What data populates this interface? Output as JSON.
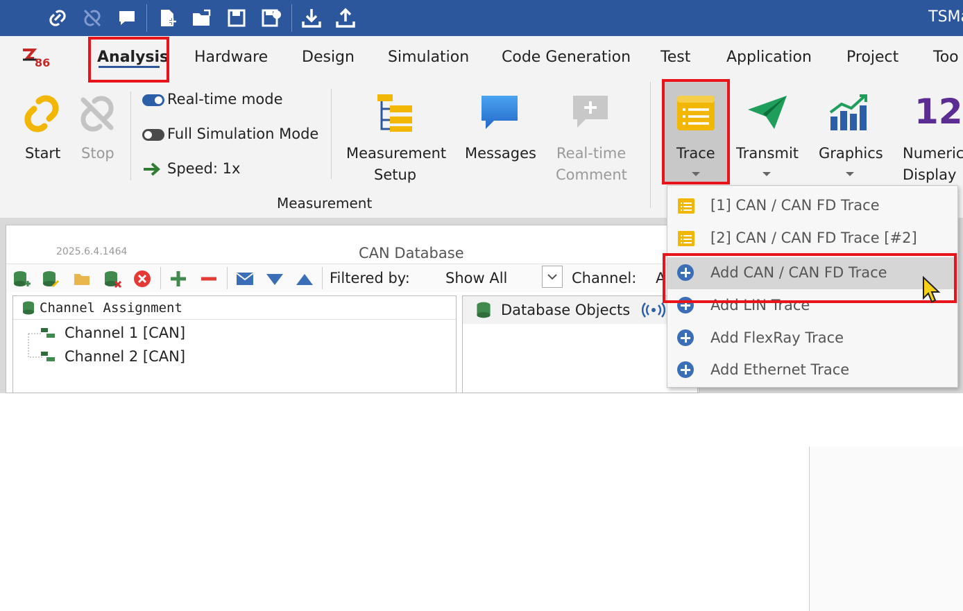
{
  "titlebar": {
    "app_title": "TSMa",
    "icons": [
      "link-icon",
      "unlink-icon",
      "comment-icon",
      "new-file-icon",
      "open-folder-icon",
      "save-icon",
      "save-as-icon",
      "download-icon",
      "upload-icon"
    ]
  },
  "ribbon": {
    "tabs": [
      "Analysis",
      "Hardware",
      "Design",
      "Simulation",
      "Code Generation",
      "Test",
      "Application",
      "Project",
      "Too"
    ],
    "active_tab": "Analysis",
    "logo_text": "TS86",
    "start_label": "Start",
    "stop_label": "Stop",
    "realtime_mode": "Real-time mode",
    "full_sim_mode": "Full Simulation Mode",
    "speed": "Speed: 1x",
    "measurement_setup": [
      "Measurement",
      "Setup"
    ],
    "messages": "Messages",
    "realtime_comment": [
      "Real-time",
      "Comment"
    ],
    "measurement_group": "Measurement",
    "trace": "Trace",
    "transmit": "Transmit",
    "graphics": "Graphics",
    "numeric_display": [
      "Numeric",
      "Display"
    ],
    "numeric_icon_text": "12"
  },
  "database": {
    "version": "2025.6.4.1464",
    "title": "CAN Database",
    "filtered_by_label": "Filtered by:",
    "filter_value": "Show All",
    "channel_label": "Channel:",
    "channel_value": "A",
    "assignment_title": "Channel Assignment",
    "channels": [
      "Channel 1 [CAN]",
      "Channel 2 [CAN]"
    ],
    "objects_tab": "Database Objects"
  },
  "trace_menu": {
    "items": [
      {
        "label": "[1] CAN / CAN FD Trace",
        "icon": "trace-list-icon"
      },
      {
        "label": "[2] CAN / CAN FD Trace [#2]",
        "icon": "trace-list-icon"
      },
      {
        "label": "Add CAN / CAN FD Trace",
        "icon": "add-circle-icon"
      },
      {
        "label": "Add LIN Trace",
        "icon": "add-circle-icon"
      },
      {
        "label": "Add FlexRay Trace",
        "icon": "add-circle-icon"
      },
      {
        "label": "Add Ethernet Trace",
        "icon": "add-circle-icon"
      }
    ]
  },
  "colors": {
    "titlebar": "#2d579c",
    "highlight_box": "#e8141a",
    "accent_blue": "#3a6fb8"
  }
}
